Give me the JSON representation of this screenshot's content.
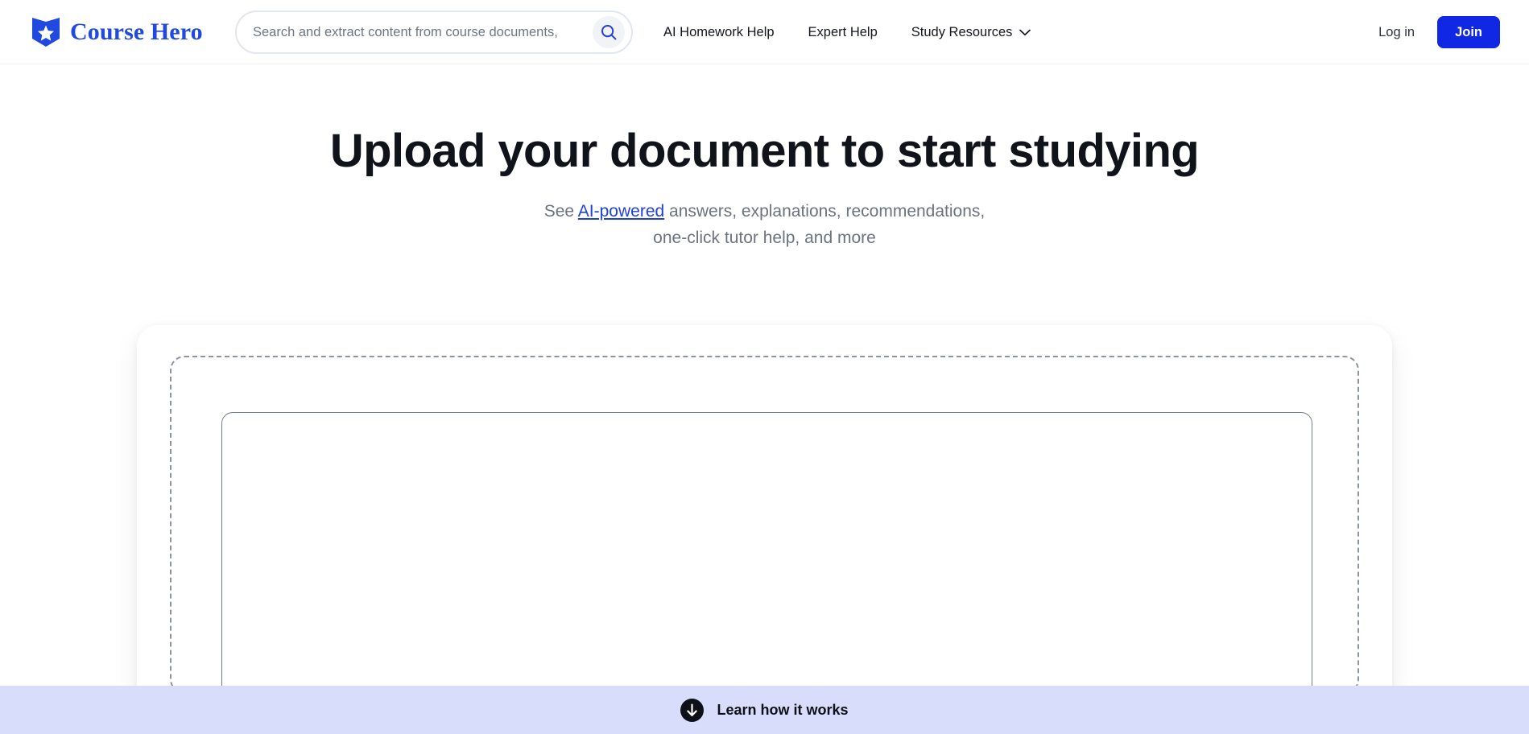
{
  "header": {
    "brand": {
      "name": "Course Hero",
      "logo_icon": "shield-star-icon",
      "logo_color": "#1f49e0"
    },
    "search": {
      "placeholder": "Search and extract content from course documents,",
      "value": "",
      "button_icon": "search-icon",
      "icon_color": "#1f3fe0"
    },
    "nav": [
      {
        "label": "AI Homework Help",
        "icon": ""
      },
      {
        "label": "Expert Help",
        "icon": ""
      },
      {
        "label": "Study Resources",
        "icon": "chevron-down-icon"
      }
    ],
    "login_label": "Log in",
    "join_label": "Join",
    "join_color": "#1028e6"
  },
  "hero": {
    "title": "Upload your document to start studying",
    "subtitle_prefix": "See ",
    "subtitle_link": "AI-powered",
    "subtitle_rest": " answers, explanations, recommendations,",
    "subtitle_line2": "one-click tutor help, and more",
    "link_color": "#1f3fe0"
  },
  "upload": {
    "region_name": "document-upload-dropzone",
    "dashed_border_color": "#8b93a5",
    "inner_border_color": "#737c8d"
  },
  "bottom_banner": {
    "label": "Learn how it works",
    "icon": "arrow-down-circle-icon",
    "background": "#d7ddfb"
  }
}
